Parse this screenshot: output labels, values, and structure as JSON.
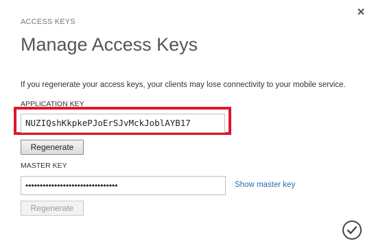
{
  "dialog": {
    "section_label": "ACCESS KEYS",
    "title": "Manage Access Keys",
    "info_text": "If you regenerate your access keys, your clients may lose connectivity to your mobile service."
  },
  "application_key": {
    "label": "APPLICATION KEY",
    "value": "NUZIQshKkpkePJoErSJvMckJoblAYB17",
    "regenerate_label": "Regenerate",
    "highlight_color": "#e0162b"
  },
  "master_key": {
    "label": "MASTER KEY",
    "value": "••••••••••••••••••••••••••••••••",
    "show_link": "Show master key",
    "regenerate_label": "Regenerate",
    "regenerate_disabled": true
  },
  "icons": {
    "close": "close-icon",
    "confirm": "checkmark-circle-icon"
  },
  "colors": {
    "link": "#1e6fb5",
    "highlight": "#e0162b"
  }
}
